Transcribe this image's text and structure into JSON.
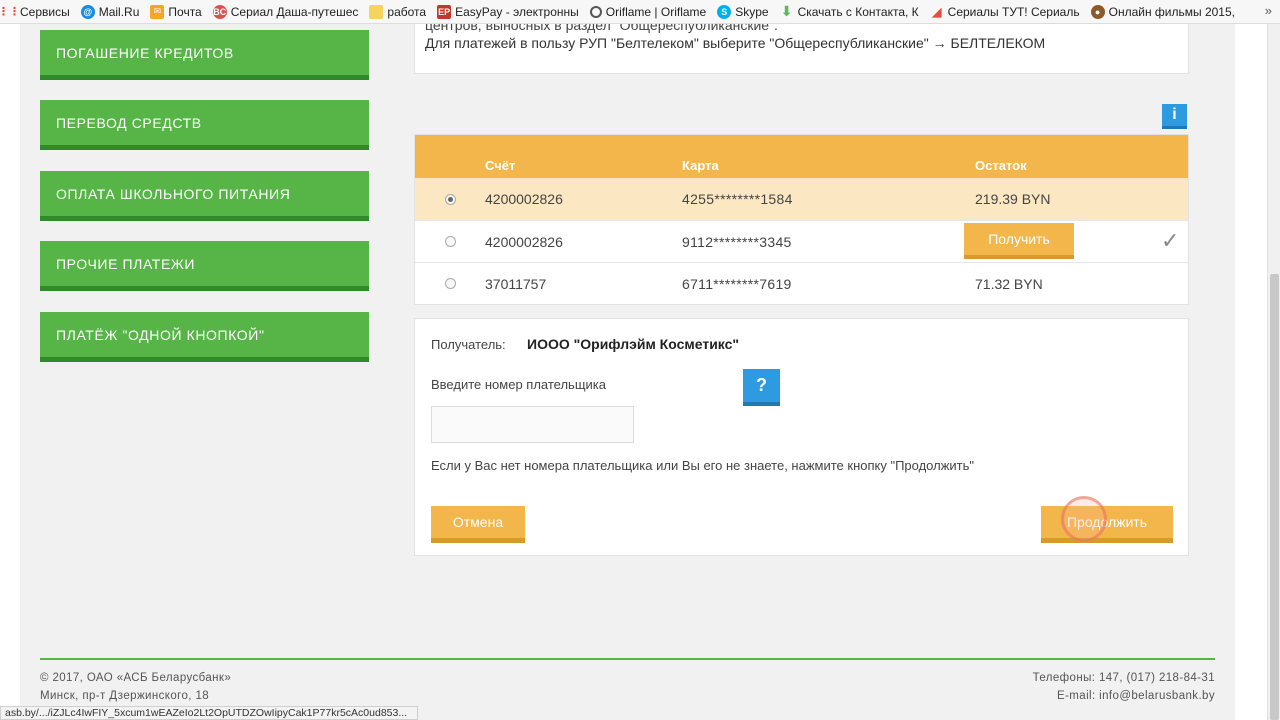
{
  "bookmarks": {
    "items": [
      {
        "label": "Сервисы",
        "icon": "apps-grid-icon",
        "color": "#e94235"
      },
      {
        "label": "Mail.Ru",
        "icon": "mailru-icon",
        "color": "#168de2"
      },
      {
        "label": "Почта",
        "icon": "mail-envelope-icon",
        "color": "#f5a623"
      },
      {
        "label": "Сериал Даша-путешес",
        "icon": "bc-site-icon",
        "color": "#d9534f"
      },
      {
        "label": "работа",
        "icon": "folder-icon",
        "color": "#f4d35e"
      },
      {
        "label": "EasyPay - электронны",
        "icon": "easypay-icon",
        "color": "#c0392b"
      },
      {
        "label": "Oriflame | Oriflame",
        "icon": "oriflame-icon",
        "color": "#555555"
      },
      {
        "label": "Skype",
        "icon": "skype-icon",
        "color": "#00aff0"
      },
      {
        "label": "Скачать с Контакта, К",
        "icon": "download-arrow-icon",
        "color": "#5cb85c"
      },
      {
        "label": "Сериалы ТУТ! Сериаль",
        "icon": "serialy-icon",
        "color": "#e74c3c"
      },
      {
        "label": "Онлайн фильмы 2015,",
        "icon": "film-icon",
        "color": "#8e5a2b"
      }
    ],
    "more": "»"
  },
  "sidebar": {
    "items": [
      {
        "label": "ПОГАШЕНИЕ КРЕДИТОВ"
      },
      {
        "label": "ПЕРЕВОД СРЕДСТВ"
      },
      {
        "label": "ОПЛАТА ШКОЛЬНОГО ПИТАНИЯ"
      },
      {
        "label": "ПРОЧИЕ ПЛАТЕЖИ"
      },
      {
        "label": "ПЛАТЁЖ \"ОДНОЙ КНОПКОЙ\""
      }
    ]
  },
  "info": {
    "line1": "центров, выносных в раздел \"Общереспубликанские\".",
    "line2": "Для платежей в пользу РУП \"Белтелеком\" выберите \"Общереспубликанские\" → БЕЛТЕЛЕКОМ",
    "info_icon": "i"
  },
  "accounts": {
    "headers": {
      "account": "Счёт",
      "card": "Карта",
      "balance": "Остаток"
    },
    "rows": [
      {
        "account": "4200002826",
        "card": "4255********1584",
        "balance": "219.39 BYN",
        "selected": true
      },
      {
        "account": "4200002826",
        "card": "9112********3345",
        "balance": "",
        "button": "Получить",
        "check": "✓",
        "selected": false
      },
      {
        "account": "37011757",
        "card": "6711********7619",
        "balance": "71.32 BYN",
        "selected": false
      }
    ]
  },
  "payment": {
    "recipient_label": "Получатель:",
    "recipient_value": "ИООО \"Орифлэйм Косметикс\"",
    "payer_prompt": "Введите номер плательщика",
    "help": "?",
    "payer_value": "",
    "hint": "Если у Вас нет номера плательщика или Вы его не знаете, нажмите кнопку \"Продолжить\"",
    "cancel": "Отмена",
    "continue": "Продолжить"
  },
  "footer": {
    "copyright": "© 2017, ОАО «АСБ Беларусбанк»",
    "address": "Минск, пр-т Дзержинского, 18",
    "phones": "Телефоны: 147, (017) 218-84-31",
    "email": "E-mail: info@belarusbank.by"
  },
  "status_bar": "asb.by/.../iZJLc4IwFIY_5xcum1wEAZeIo2Lt2OpUTDZOwIipyCak1P77kr5cAc0ud853...",
  "colors": {
    "menu_green": "#57b547",
    "table_orange": "#f2b64a",
    "help_blue": "#2e9be0"
  }
}
